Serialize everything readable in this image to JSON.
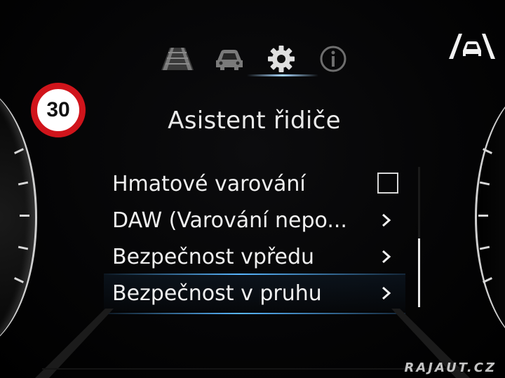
{
  "header": {
    "tabs": [
      {
        "icon": "road-lanes-icon",
        "active": false
      },
      {
        "icon": "car-icon",
        "active": false
      },
      {
        "icon": "gear-icon",
        "active": true
      },
      {
        "icon": "info-icon",
        "active": false
      }
    ],
    "lane_assist_icon": "lane-assist-icon"
  },
  "speed_limit": {
    "value": "30"
  },
  "page": {
    "title": "Asistent řidiče"
  },
  "menu": {
    "items": [
      {
        "label": "Hmatové varování",
        "control": "checkbox",
        "checked": false
      },
      {
        "label": "DAW (Varování nepo...",
        "control": "chevron"
      },
      {
        "label": "Bezpečnost vpředu",
        "control": "chevron"
      },
      {
        "label": "Bezpečnost v pruhu",
        "control": "chevron",
        "selected": true
      }
    ]
  },
  "watermark": {
    "text": "RAJAUT.CZ"
  },
  "colors": {
    "accent": "#58b6ff",
    "speed_sign_ring": "#d0141b",
    "text": "#f0f0f0"
  }
}
